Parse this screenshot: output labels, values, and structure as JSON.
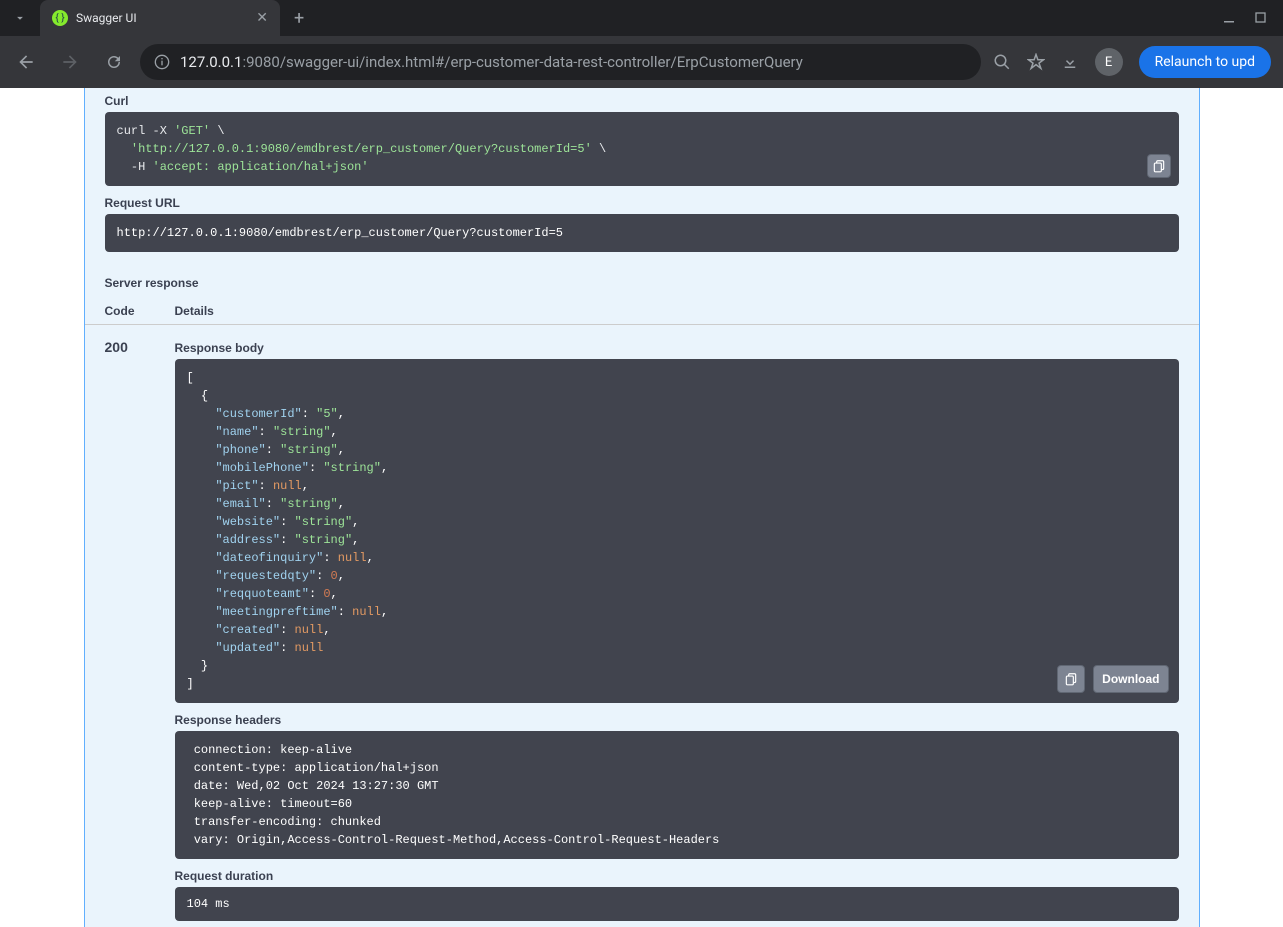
{
  "browser": {
    "tab_title": "Swagger UI",
    "url_host": "127.0.0.1",
    "url_port": ":9080",
    "url_path": "/swagger-ui/index.html#/erp-customer-data-rest-controller/ErpCustomerQuery",
    "profile_initial": "E",
    "relaunch_label": "Relaunch to upd"
  },
  "swagger": {
    "curl_label": "Curl",
    "curl": {
      "line1_prefix": "curl -X ",
      "line1_method": "'GET'",
      "line1_suffix": " \\",
      "line2_prefix": "  ",
      "line2_url": "'http://127.0.0.1:9080/emdbrest/erp_customer/Query?customerId=5'",
      "line2_suffix": " \\",
      "line3_prefix": "  -H ",
      "line3_header": "'accept: application/hal+json'"
    },
    "request_url_label": "Request URL",
    "request_url": "http://127.0.0.1:9080/emdbrest/erp_customer/Query?customerId=5",
    "server_response_label": "Server response",
    "code_header": "Code",
    "details_header": "Details",
    "response_code": "200",
    "response_body_label": "Response body",
    "download_label": "Download",
    "response_body": {
      "rows": [
        {
          "key": "customerId",
          "type": "str",
          "val": "\"5\"",
          "comma": true
        },
        {
          "key": "name",
          "type": "str",
          "val": "\"string\"",
          "comma": true
        },
        {
          "key": "phone",
          "type": "str",
          "val": "\"string\"",
          "comma": true
        },
        {
          "key": "mobilePhone",
          "type": "str",
          "val": "\"string\"",
          "comma": true
        },
        {
          "key": "pict",
          "type": "nul",
          "val": "null",
          "comma": true
        },
        {
          "key": "email",
          "type": "str",
          "val": "\"string\"",
          "comma": true
        },
        {
          "key": "website",
          "type": "str",
          "val": "\"string\"",
          "comma": true
        },
        {
          "key": "address",
          "type": "str",
          "val": "\"string\"",
          "comma": true
        },
        {
          "key": "dateofinquiry",
          "type": "nul",
          "val": "null",
          "comma": true
        },
        {
          "key": "requestedqty",
          "type": "num",
          "val": "0",
          "comma": true
        },
        {
          "key": "reqquoteamt",
          "type": "num",
          "val": "0",
          "comma": true
        },
        {
          "key": "meetingpreftime",
          "type": "nul",
          "val": "null",
          "comma": true
        },
        {
          "key": "created",
          "type": "nul",
          "val": "null",
          "comma": true
        },
        {
          "key": "updated",
          "type": "nul",
          "val": "null",
          "comma": false
        }
      ]
    },
    "response_headers_label": "Response headers",
    "response_headers": " connection: keep-alive \n content-type: application/hal+json \n date: Wed,02 Oct 2024 13:27:30 GMT \n keep-alive: timeout=60 \n transfer-encoding: chunked \n vary: Origin,Access-Control-Request-Method,Access-Control-Request-Headers ",
    "request_duration_label": "Request duration",
    "request_duration": "104 ms"
  }
}
